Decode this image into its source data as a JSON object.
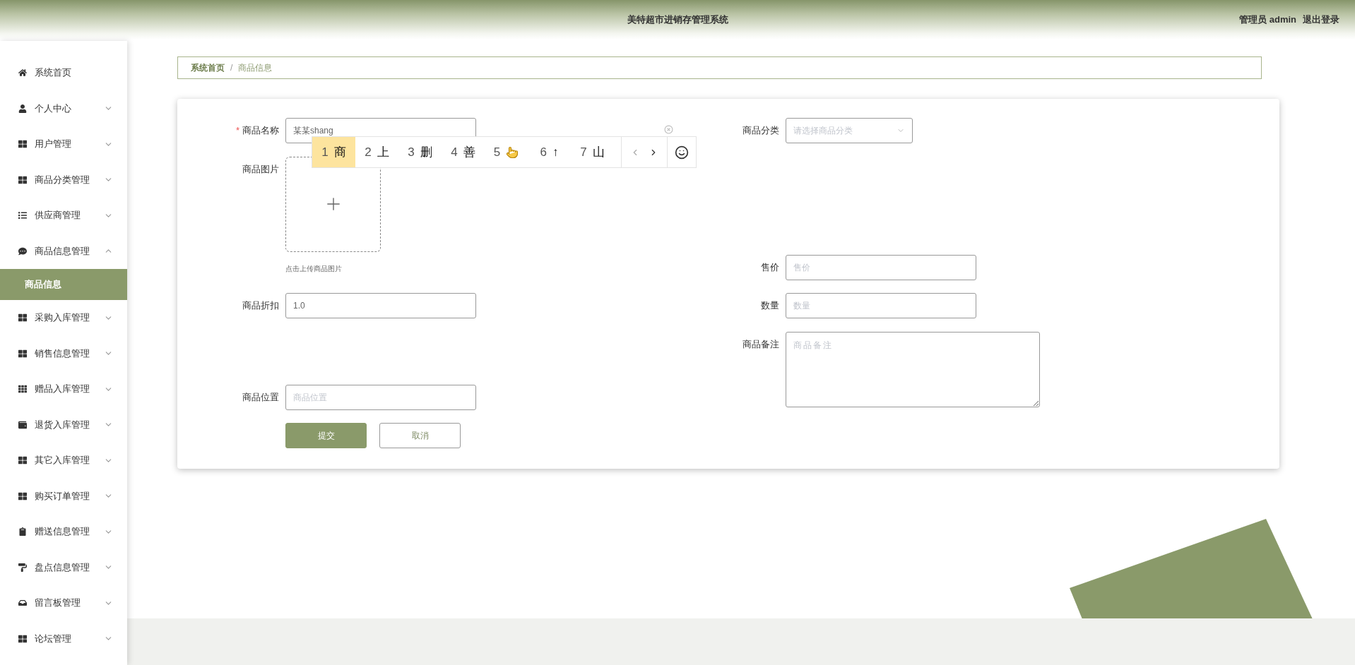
{
  "header": {
    "title": "美特超市进销存管理系统",
    "user": "管理员 admin",
    "logout": "退出登录"
  },
  "sidebar": {
    "items": [
      {
        "label": "系统首页",
        "kind": "link"
      },
      {
        "label": "个人中心",
        "kind": "menu",
        "expanded": false
      },
      {
        "label": "用户管理",
        "kind": "menu",
        "expanded": false
      },
      {
        "label": "商品分类管理",
        "kind": "menu",
        "expanded": false
      },
      {
        "label": "供应商管理",
        "kind": "menu",
        "expanded": false
      },
      {
        "label": "商品信息管理",
        "kind": "menu",
        "expanded": true,
        "children": [
          {
            "label": "商品信息",
            "selected": true
          }
        ]
      },
      {
        "label": "采购入库管理",
        "kind": "menu",
        "expanded": false
      },
      {
        "label": "销售信息管理",
        "kind": "menu",
        "expanded": false
      },
      {
        "label": "赠品入库管理",
        "kind": "menu",
        "expanded": false
      },
      {
        "label": "退货入库管理",
        "kind": "menu",
        "expanded": false
      },
      {
        "label": "其它入库管理",
        "kind": "menu",
        "expanded": false
      },
      {
        "label": "购买订单管理",
        "kind": "menu",
        "expanded": false
      },
      {
        "label": "赠送信息管理",
        "kind": "menu",
        "expanded": false
      },
      {
        "label": "盘点信息管理",
        "kind": "menu",
        "expanded": false
      },
      {
        "label": "留言板管理",
        "kind": "menu",
        "expanded": false
      },
      {
        "label": "论坛管理",
        "kind": "menu",
        "expanded": false
      }
    ]
  },
  "breadcrumb": [
    "系统首页",
    "商品信息"
  ],
  "breadcrumb_separator": "/",
  "form": {
    "required_mark": "*",
    "left_fields": [
      {
        "label": "商品名称",
        "kind": "text",
        "required": true,
        "value": "某某shang"
      },
      {
        "label": "商品图片",
        "kind": "upload",
        "required": false,
        "hint": "点击上传商品图片"
      },
      {
        "label": "商品折扣",
        "kind": "text",
        "required": false,
        "value": "1.0"
      },
      {
        "label": "商品位置",
        "kind": "text",
        "required": false,
        "placeholder": "商品位置"
      }
    ],
    "right_fields": [
      {
        "label": "商品分类",
        "kind": "select",
        "required": false,
        "placeholder": "请选择商品分类"
      },
      {
        "label": "售价",
        "kind": "text",
        "required": false,
        "placeholder": "售价"
      },
      {
        "label": "数量",
        "kind": "text",
        "required": false,
        "placeholder": "数量"
      },
      {
        "label": "商品备注",
        "kind": "textarea",
        "required": false,
        "placeholder": "商品备注"
      }
    ],
    "buttons": [
      {
        "label": "提交",
        "kind": "primary"
      },
      {
        "label": "取消",
        "kind": "default"
      }
    ]
  },
  "ime_popup": {
    "candidates": [
      {
        "number": "1",
        "kind": "text",
        "text": "商",
        "selected": true
      },
      {
        "number": "2",
        "kind": "text",
        "text": "上",
        "selected": false
      },
      {
        "number": "3",
        "kind": "text",
        "text": "删",
        "selected": false
      },
      {
        "number": "4",
        "kind": "text",
        "text": "善",
        "selected": false
      },
      {
        "number": "5",
        "kind": "icon",
        "selected": false
      },
      {
        "number": "6",
        "kind": "text",
        "text": "↑",
        "selected": false
      },
      {
        "number": "7",
        "kind": "text",
        "text": "山",
        "selected": false
      }
    ]
  }
}
